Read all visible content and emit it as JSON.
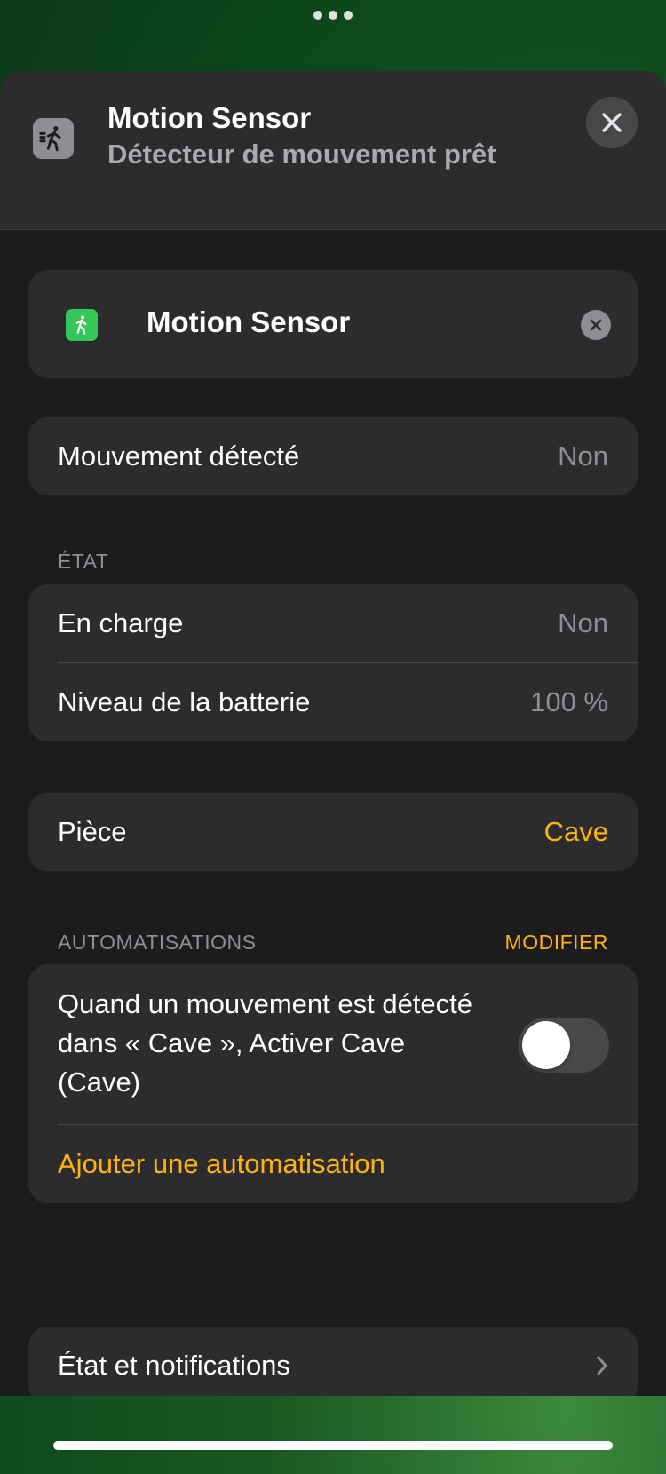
{
  "header": {
    "icon": "motion-sensor-icon",
    "title": "Motion Sensor",
    "subtitle": "Détecteur de mouvement prêt",
    "close_icon": "close-icon"
  },
  "accessory": {
    "icon": "motion-sensor-icon",
    "name": "Motion Sensor",
    "remove_icon": "remove-icon"
  },
  "motion": {
    "label": "Mouvement détecté",
    "value": "Non"
  },
  "state_section": {
    "title": "ÉTAT",
    "rows": [
      {
        "label": "En charge",
        "value": "Non"
      },
      {
        "label": "Niveau de la batterie",
        "value": "100 %"
      }
    ]
  },
  "room": {
    "label": "Pièce",
    "value": "Cave"
  },
  "automations_section": {
    "title": "AUTOMATISATIONS",
    "action": "MODIFIER",
    "automation_text": "Quand un mouvement est détecté dans « Cave », Activer Cave (Cave)",
    "toggle_on": false,
    "add_label": "Ajouter une automatisation"
  },
  "status_notifications": {
    "label": "État et notifications"
  },
  "colors": {
    "accent": "#ffb30f",
    "sheet_bg": "#1c1c1e",
    "card_bg": "#2c2c2e",
    "sensor_green": "#34c759"
  }
}
